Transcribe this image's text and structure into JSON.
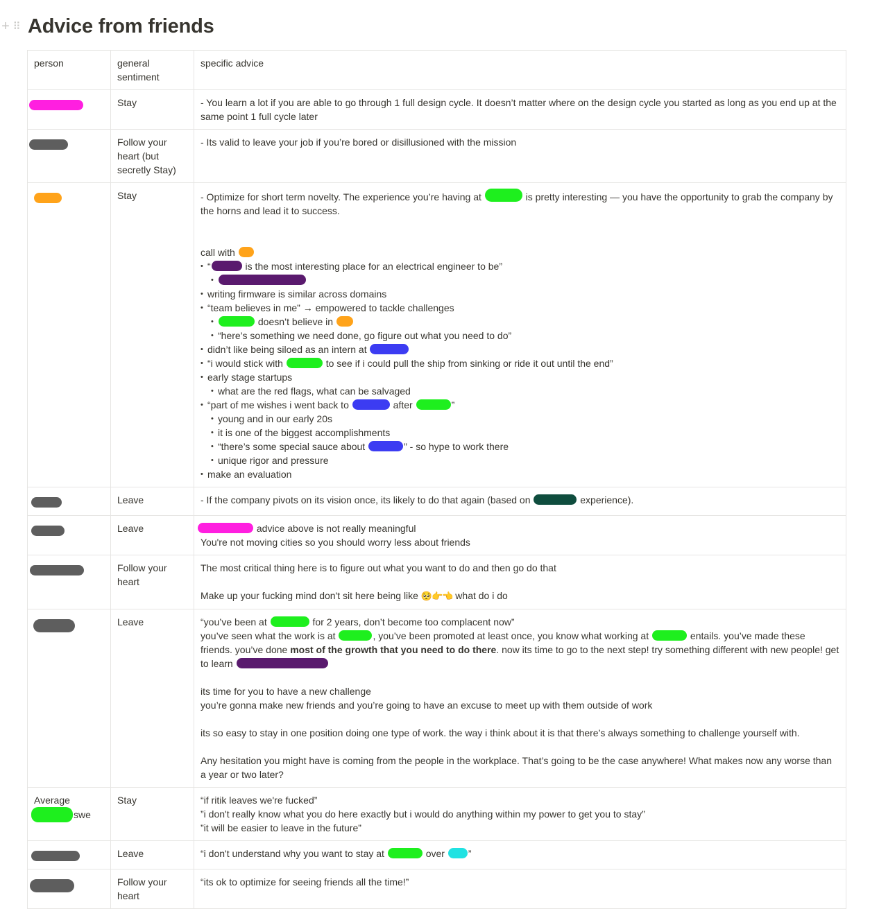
{
  "page": {
    "title": "Advice from friends"
  },
  "table": {
    "headers": [
      "person",
      "general sentiment",
      "specific advice"
    ],
    "row1": {
      "sentiment": "Stay",
      "l1": "- You learn a lot if you are able to go through 1 full design cycle. It doesn’t matter where on the design cycle you started as long as you end up at the same point 1 full cycle later"
    },
    "row2": {
      "sentiment": "Follow your heart (but secretly Stay)",
      "l1": "- Its valid to leave your job if you’re bored or disillusioned with the mission"
    },
    "row3": {
      "sentiment": "Stay",
      "p1a": "- Optimize for short term novelty. The experience you’re having at ",
      "p1b": " is pretty interesting — you have the opportunity to grab the company by the horns and lead it to success.",
      "call": "call with ",
      "q1a": "“",
      "q1b": " is the most interesting place for an electrical engineer to be”",
      "b2": "writing firmware is similar across domains",
      "b3": "“team believes in me” → empowered to tackle challenges",
      "b3s1": " doesn’t believe in ",
      "b3s2": "“here’s something we need done, go figure out what you need to do”",
      "b4": "didn’t like being siloed as an intern at ",
      "b5a": "“i would stick with ",
      "b5b": " to see if i could pull the ship from sinking or ride it out until the end”",
      "b6": "early stage startups",
      "b6s1": "what are the red flags, what can be salvaged",
      "b7a": "“part of me wishes i went back to ",
      "b7b": " after ",
      "b7c": "”",
      "b7s1": "young and in our early 20s",
      "b7s2": "it is one of the biggest accomplishments",
      "b7s3a": "“there’s some special sauce about ",
      "b7s3b": "” - so hype to work there",
      "b7s4": "unique rigor and pressure",
      "b8": "make an evaluation"
    },
    "row4": {
      "sentiment": "Leave",
      "l1a": "- If the company pivots on its vision once, its likely to do that again (based on ",
      "l1b": " experience)."
    },
    "row5": {
      "sentiment": "Leave",
      "l1": " advice above is not really meaningful",
      "l2": "You're not moving cities so you should worry less about friends"
    },
    "row6": {
      "sentiment": "Follow your heart",
      "l1": "The most critical thing here is to figure out what you want to do and then go do that",
      "l2a": "Make up your fucking mind don't sit here being like ",
      "l2emoji": "🥺👉👈",
      "l2b": " what do i do"
    },
    "row7": {
      "sentiment": "Leave",
      "l1a": "“you’ve been at ",
      "l1b": " for 2 years, don’t become too complacent now”",
      "p2a": "you’ve seen what the work is at ",
      "p2b": ", you’ve been promoted at least once, you know what working at ",
      "p2c": " entails. you’ve made these friends. you’ve done ",
      "p2bold": "most of the growth that you need to do there",
      "p2d": ". now its time to go to the next step! try something different with new people! get to learn ",
      "l3": "its time for you to have a new challenge",
      "l4": "you’re gonna make new friends and you’re going to have an excuse to meet up with them outside of work",
      "l5": "its so easy to stay in one position doing one type of work. the way i think about it is that there’s always something to challenge yourself with.",
      "l6": "Any hesitation you might have is coming from the people in the workplace. That’s going to be the case anywhere! What makes now any worse than a year or two later?"
    },
    "row8": {
      "person_top": "Average",
      "person_bottom": "swe",
      "sentiment": "Stay",
      "l1": "“if ritik leaves we're fucked”",
      "l2": "”i don't really know what you do here exactly but i would do  anything within my power to get you to stay”",
      "l3": "”it will be easier to leave in the future”"
    },
    "row9": {
      "sentiment": "Leave",
      "l1a": "“i don't understand why you want to stay at ",
      "l1b": " over ",
      "l1c": "”"
    },
    "row10": {
      "sentiment": "Follow your heart",
      "l1": "“its ok to optimize for seeing friends all the time!”"
    }
  },
  "colors": {
    "magenta": "#ff1fe0",
    "gray": "#5e5e5e",
    "orange": "#ffa31a",
    "green": "#1eef1e",
    "purple": "#5a1a6e",
    "blue": "#3c3cf2",
    "teal": "#0f4d3e",
    "cyan": "#20e2e2"
  }
}
